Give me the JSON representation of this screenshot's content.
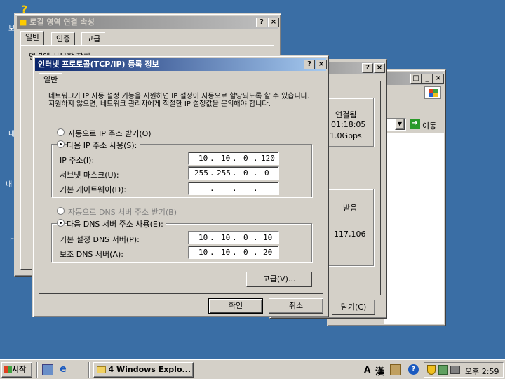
{
  "desktop": {
    "icon_label_1": "내",
    "icon_label_2": "내",
    "icon_label_3": "E",
    "icon_label_4": "보"
  },
  "back_window": {
    "title": "로컬 영역 연결 속성",
    "help_btn": "?",
    "close_btn": "×",
    "tabs": [
      "일반",
      "인증",
      "고급"
    ],
    "connect_label": "연결에 사용할 장치:"
  },
  "status_window": {
    "help_btn": "?",
    "close_btn": "×",
    "status_header": "연결됨",
    "duration": "01:18:05",
    "speed": "1.0Gbps",
    "received_header": "받음",
    "received_count": "117,106",
    "close_label": "닫기(C)"
  },
  "explorer_window": {
    "min_btn": "_",
    "max_btn": "□",
    "close_btn": "×",
    "go_label": "이동"
  },
  "tcpip_dialog": {
    "title": "인터넷 프로토콜(TCP/IP) 등록 정보",
    "help_btn": "?",
    "close_btn": "×",
    "tab_general": "일반",
    "description": "네트워크가 IP 자동 설정 기능을 지원하면 IP 설정이 자동으로 할당되도록 할 수 있습니다. 지원하지 않으면, 네트워크 관리자에게 적절한 IP 설정값을 문의해야 합니다.",
    "auto_ip": "자동으로 IP 주소 받기(O)",
    "use_ip": "다음 IP 주소 사용(S):",
    "ip_label": "IP 주소(I):",
    "ip_value": [
      "10",
      "10",
      "0",
      "120"
    ],
    "subnet_label": "서브넷 마스크(U):",
    "subnet_value": [
      "255",
      "255",
      "0",
      "0"
    ],
    "gateway_label": "기본 게이트웨이(D):",
    "gateway_value": [
      "",
      "",
      "",
      ""
    ],
    "auto_dns": "자동으로 DNS 서버 주소 받기(B)",
    "use_dns": "다음 DNS 서버 주소 사용(E):",
    "pref_dns_label": "기본 설정 DNS 서버(P):",
    "pref_dns_value": [
      "10",
      "10",
      "0",
      "10"
    ],
    "alt_dns_label": "보조 DNS 서버(A):",
    "alt_dns_value": [
      "10",
      "10",
      "0",
      "20"
    ],
    "advanced_btn": "고급(V)...",
    "ok_btn": "확인",
    "cancel_btn": "취소"
  },
  "taskbar": {
    "start_label": "시작",
    "task_label": "4 Windows Explo...",
    "ime_a": "A",
    "ime_han": "漢",
    "clock": "오후 2:59"
  }
}
